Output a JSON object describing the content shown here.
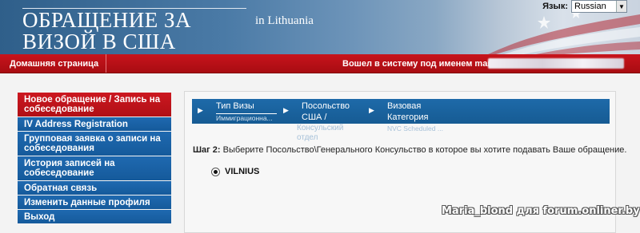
{
  "header": {
    "title_line1": "ОБРАЩЕНИЕ ЗА",
    "title_line2": "ВИЗОЙ В США",
    "subtitle": "in  Lithuania",
    "language_label": "Язык:",
    "language_value": "Russian"
  },
  "navbar": {
    "home_label": "Домашняя страница",
    "logged_in_text": "Вошел в систему под именем  maria"
  },
  "sidebar": {
    "items": [
      {
        "label": "Новое обращение / Запись на собеседование",
        "active": true
      },
      {
        "label": "IV Address Registration",
        "active": false
      },
      {
        "label": "Групповая заявка о записи на собеседования",
        "active": false
      },
      {
        "label": "История записей на собеседование",
        "active": false
      },
      {
        "label": "Обратная связь",
        "active": false
      },
      {
        "label": "Изменить данные профиля",
        "active": false
      },
      {
        "label": "Выход",
        "active": false
      }
    ]
  },
  "steps": [
    {
      "label": "Тип Визы",
      "sub": "Иммиграционна..."
    },
    {
      "label": "Посольство",
      "label2": "США /",
      "faded": [
        "Консульский",
        "отдел"
      ]
    },
    {
      "label": "Визовая",
      "label2": "Категория",
      "sub": "NVC Scheduled ..."
    }
  ],
  "main": {
    "instruction_step": "Шаг 2:",
    "instruction_text": " Выберите Посольство\\Генерального Консульство в которое вы хотите подавать Ваше обращение.",
    "options": [
      {
        "label": "VILNIUS",
        "selected": true
      }
    ]
  },
  "watermark": "Maria_blond для forum.onliner.by",
  "colors": {
    "banner_blue": "#2f5f8a",
    "nav_red": "#b00f16",
    "sidebar_blue": "#1a63a8",
    "active_red": "#cc1820"
  }
}
